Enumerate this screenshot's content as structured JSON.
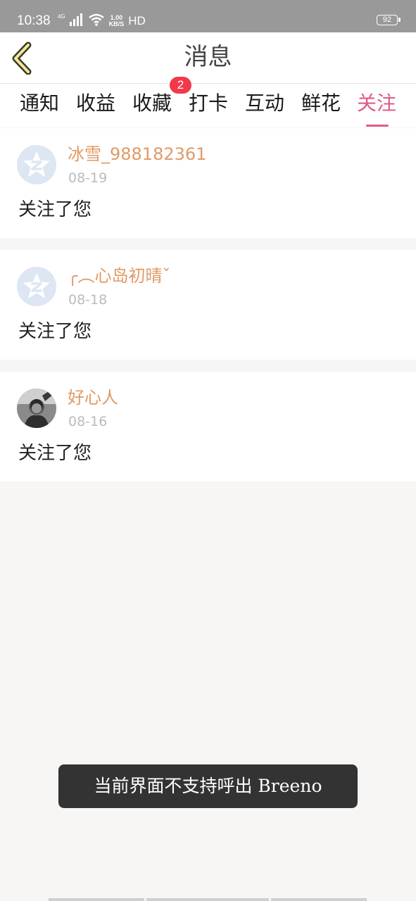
{
  "status_bar": {
    "time": "10:38",
    "network_label": "4G",
    "speed_value": "1.00",
    "speed_unit": "KB/S",
    "hd_label": "HD",
    "battery_level": "92"
  },
  "header": {
    "title": "消息",
    "back_icon": "chevron-left-icon"
  },
  "tabs": [
    {
      "label": "通知"
    },
    {
      "label": "收益"
    },
    {
      "label": "收藏",
      "badge": "2"
    },
    {
      "label": "打卡"
    },
    {
      "label": "互动"
    },
    {
      "label": "鲜花"
    },
    {
      "label": "关注",
      "active": true
    }
  ],
  "messages": [
    {
      "username": "冰雪_988182361",
      "date": "08-19",
      "text": "关注了您",
      "avatar": "default-avatar-icon"
    },
    {
      "username": "╭︵心岛初晴ˇ",
      "date": "08-18",
      "text": "关注了您",
      "avatar": "default-avatar-icon"
    },
    {
      "username": "好心人",
      "date": "08-16",
      "text": "关注了您",
      "avatar": "user-photo"
    }
  ],
  "toast": {
    "text": "当前界面不支持呼出 Breeno"
  },
  "colors": {
    "accent": "#e05a8a",
    "username": "#e09a66",
    "badge": "#f03a4a",
    "status_bar": "#999999",
    "page_background": "#f8f5f5"
  }
}
